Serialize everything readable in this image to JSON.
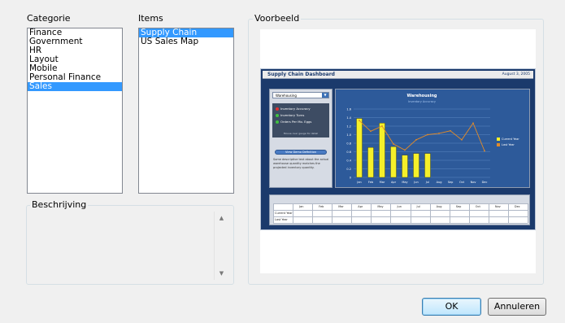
{
  "categories": {
    "label": "Categorie",
    "items": [
      "Finance",
      "Government",
      "HR",
      "Layout",
      "Mobile",
      "Personal Finance",
      "Sales"
    ],
    "selected_index": 6
  },
  "items": {
    "label": "Items",
    "items": [
      "Supply Chain",
      "US Sales Map"
    ],
    "selected_index": 0
  },
  "description": {
    "label": "Beschrijving",
    "text": ""
  },
  "preview": {
    "label": "Voorbeeld",
    "dashboard": {
      "title": "Supply Chain Dashboard",
      "date": "August 3, 2005",
      "dropdown_value": "Warehousing",
      "gauges": [
        {
          "label": "Inventory Accuracy",
          "color": "#e03030"
        },
        {
          "label": "Inventory Turns",
          "color": "#40c040"
        },
        {
          "label": "Orders Per Mo. Eggs",
          "color": "#40c040"
        }
      ],
      "gauge_footer": "Mouse over gauge for detail",
      "button_label": "View Demo Definition",
      "note": "Some descriptive text about the actual warehouse quantity matches the projected inventory quantity.",
      "chart_title": "Warehousing",
      "chart_subtitle": "Inventory Accuracy",
      "legend": [
        "Current Year",
        "Last Year"
      ],
      "table_rows": [
        "Current Year",
        "Last Year"
      ]
    }
  },
  "buttons": {
    "ok": "OK",
    "cancel": "Annuleren"
  },
  "chart_data": {
    "type": "bar",
    "title": "Warehousing",
    "subtitle": "Inventory Accuracy",
    "categories": [
      "Jan",
      "Feb",
      "Mar",
      "Apr",
      "May",
      "Jun",
      "Jul",
      "Aug",
      "Sep",
      "Oct",
      "Nov",
      "Dec"
    ],
    "ylim": [
      0,
      1.6
    ],
    "yticks": [
      "0",
      "0.2",
      "0.4",
      "0.6",
      "0.8",
      "1.0",
      "1.2",
      "1.4",
      "1.6"
    ],
    "series": [
      {
        "name": "Current Year",
        "type": "bar",
        "color": "#f5f02a",
        "values": [
          1.38,
          0.7,
          1.27,
          0.72,
          0.52,
          0.56,
          0.56,
          null,
          null,
          null,
          null,
          null
        ]
      },
      {
        "name": "Last Year",
        "type": "line",
        "color": "#e08a2a",
        "values": [
          1.33,
          1.08,
          1.2,
          0.78,
          0.64,
          0.88,
          1.0,
          1.03,
          1.09,
          0.88,
          1.27,
          0.62
        ]
      }
    ],
    "colors": {
      "background": "#2d5a9a",
      "grid": "#5a86c2",
      "text": "#ffffff"
    },
    "legend_position": "right"
  }
}
